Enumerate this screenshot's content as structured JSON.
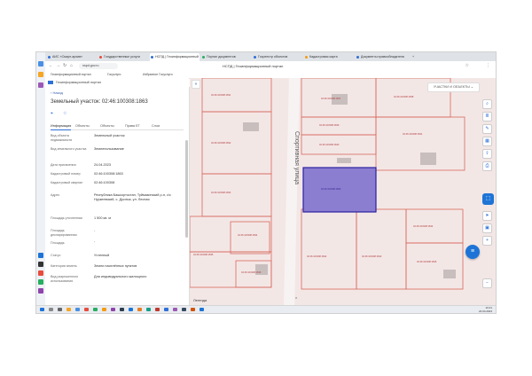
{
  "browser": {
    "tabs": [
      {
        "label": "АИС «Смарт-архив»",
        "color": "#2e6fd8"
      },
      {
        "label": "Государственные услуги",
        "color": "#e74c3c"
      },
      {
        "label": "НСПД | Геоинформационный",
        "color": "#2e6fd8"
      },
      {
        "label": "Портал документов",
        "color": "#27ae60"
      },
      {
        "label": "Госреестр объектов",
        "color": "#2e6fd8"
      },
      {
        "label": "Кадастровая карта",
        "color": "#f39c12"
      },
      {
        "label": "Документы правообладателя",
        "color": "#2e6fd8"
      }
    ],
    "url": "nspd.gov.ru",
    "window_title": "НСПД | Геоинформационный портал",
    "bookmarks": [
      "Геоинформационный портал",
      "Госуслуги",
      "Избранное Госуслуги"
    ]
  },
  "site": {
    "title": "Геоинформационный портал"
  },
  "panel": {
    "back_label": "Назад",
    "object_title": "Земельный участок: 02:46:100308:1863",
    "tabs": [
      "Информация",
      "Объекты",
      "Объекты",
      "Права ЕГ",
      "Слои"
    ],
    "rows": [
      {
        "label": "Вид объекта недвижимости",
        "value": "Земельный участок"
      },
      {
        "label": "Вид земельного участка",
        "value": "Землепользование"
      },
      {
        "label": "Дата присвоения",
        "value": "24.04.2023"
      },
      {
        "label": "Кадастровый номер",
        "value": "02:46:100308:1863"
      },
      {
        "label": "Кадастровый квартал",
        "value": "02:46:100308"
      },
      {
        "label": "Адрес",
        "value": "Республика Башкортостан, Туймазинский р-н, с/с Нуркеевский, с. Дуслык, ул. Лесная"
      },
      {
        "label": "Площадь уточненная",
        "value": "1 500 кв. м"
      },
      {
        "label": "Площадь декларированная",
        "value": "-"
      },
      {
        "label": "Площадь",
        "value": "-"
      },
      {
        "label": "Статус",
        "value": "Учтенный"
      },
      {
        "label": "Категория земель",
        "value": "Земли населённых пунктов"
      },
      {
        "label": "Вид разрешенного использования",
        "value": "Для индивидуального жилищного"
      }
    ]
  },
  "map": {
    "layer_button": "УЧАСТКИ И ОБЪЕКТЫ",
    "street": "Спортивная улица",
    "legend": "Легенда",
    "parcel_labels": [
      "02:46:100308:1831",
      "02:46:100308:1832",
      "02:46:100308:1833",
      "02:46:100308:1834",
      "02:46:100308:1835",
      "02:46:100308:1836",
      "02:46:100308:1837",
      "02:46:100308:1838",
      "02:46:100308:1839",
      "02:46:100308:1840",
      "02:46:100308:1841",
      "02:46:100308:1842",
      "02:46:100308:1843",
      "02:46:100308:1844",
      "02:46:100308:1845"
    ],
    "selected_label": "02:46:100308:1863"
  },
  "taskbar": {
    "time": "10:21",
    "date": "24.04.2023"
  }
}
